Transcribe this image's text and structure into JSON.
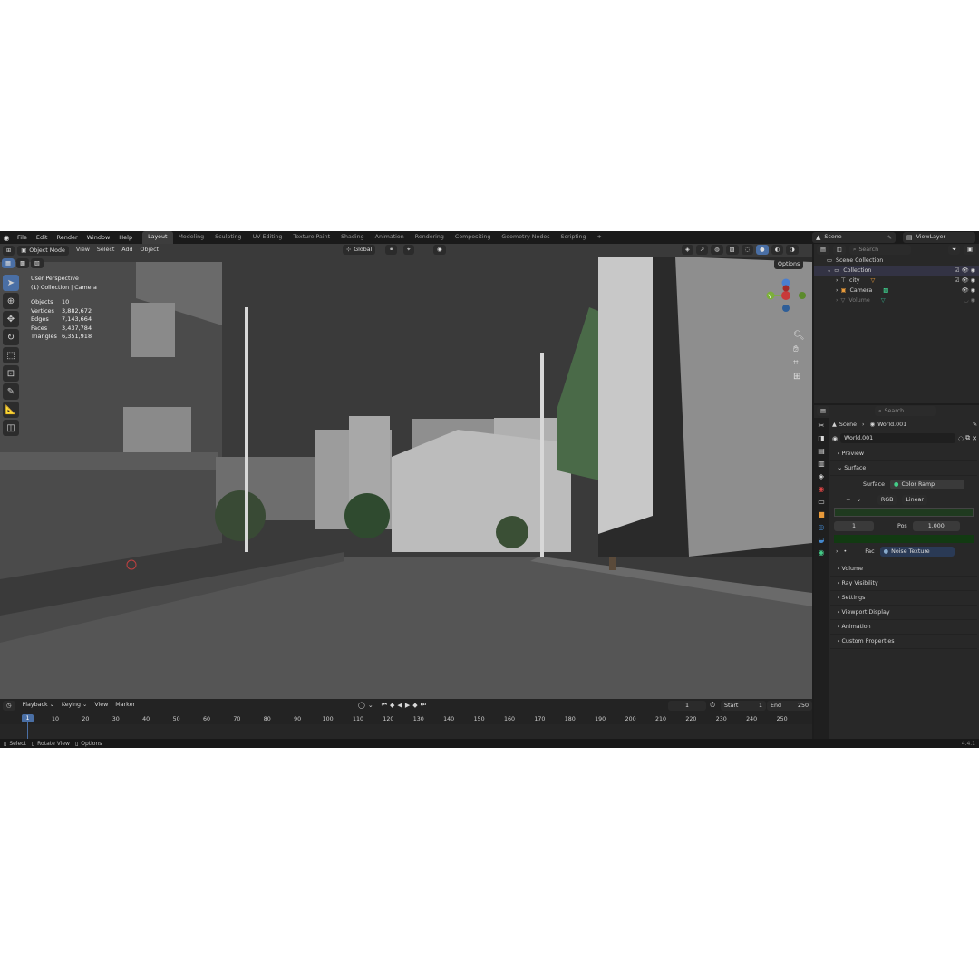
{
  "topbar": {
    "menus": [
      "File",
      "Edit",
      "Render",
      "Window",
      "Help"
    ],
    "workspaces": [
      "Layout",
      "Modeling",
      "Sculpting",
      "UV Editing",
      "Texture Paint",
      "Shading",
      "Animation",
      "Rendering",
      "Compositing",
      "Geometry Nodes",
      "Scripting"
    ],
    "active_workspace": "Layout",
    "add_tab": "+",
    "scene_name": "Scene",
    "view_layer": "ViewLayer"
  },
  "viewport": {
    "mode": "Object Mode",
    "menus": [
      "View",
      "Select",
      "Add",
      "Object"
    ],
    "transform_orientation": "Global",
    "options_label": "Options",
    "perspective_label": "User Perspective",
    "collection_label": "(1) Collection | Camera",
    "stats": [
      {
        "label": "Objects",
        "value": "10"
      },
      {
        "label": "Vertices",
        "value": "3,882,672"
      },
      {
        "label": "Edges",
        "value": "7,143,664"
      },
      {
        "label": "Faces",
        "value": "3,437,784"
      },
      {
        "label": "Triangles",
        "value": "6,351,918"
      }
    ],
    "gizmo_axis_label": "Y",
    "colors": {
      "background": "#3a3a3a",
      "accent": "#4a6fa5"
    }
  },
  "outliner": {
    "search_placeholder": "Search",
    "root": "Scene Collection",
    "collection": "Collection",
    "items": [
      {
        "name": "city",
        "icon": "empty-icon"
      },
      {
        "name": "Camera",
        "icon": "camera-icon"
      },
      {
        "name": "Volume",
        "icon": "volume-icon"
      }
    ]
  },
  "properties": {
    "search_placeholder": "Search",
    "breadcrumb_scene": "Scene",
    "breadcrumb_world": "World.001",
    "world_name": "World.001",
    "sections_top": [
      "Preview",
      "Surface"
    ],
    "surface_label": "Surface",
    "surface_value": "Color Ramp",
    "color_mode": "RGB",
    "interpolation": "Linear",
    "stop_index": "1",
    "pos_label": "Pos",
    "pos_value": "1.000",
    "fac_label": "Fac",
    "fac_value": "Noise Texture",
    "sections_bottom": [
      "Volume",
      "Ray Visibility",
      "Settings",
      "Viewport Display",
      "Animation",
      "Custom Properties"
    ]
  },
  "timeline": {
    "menus": [
      "Playback",
      "Keying",
      "View",
      "Marker"
    ],
    "current_frame": "1",
    "start_label": "Start",
    "start_value": "1",
    "end_label": "End",
    "end_value": "250",
    "ticks": [
      "10",
      "20",
      "30",
      "40",
      "50",
      "60",
      "70",
      "80",
      "90",
      "100",
      "110",
      "120",
      "130",
      "140",
      "150",
      "160",
      "170",
      "180",
      "190",
      "200",
      "210",
      "220",
      "230",
      "240",
      "250"
    ],
    "playhead": "1"
  },
  "statusbar": {
    "select": "Select",
    "rotate": "Rotate View",
    "options": "Options",
    "version": "4.4.1"
  }
}
